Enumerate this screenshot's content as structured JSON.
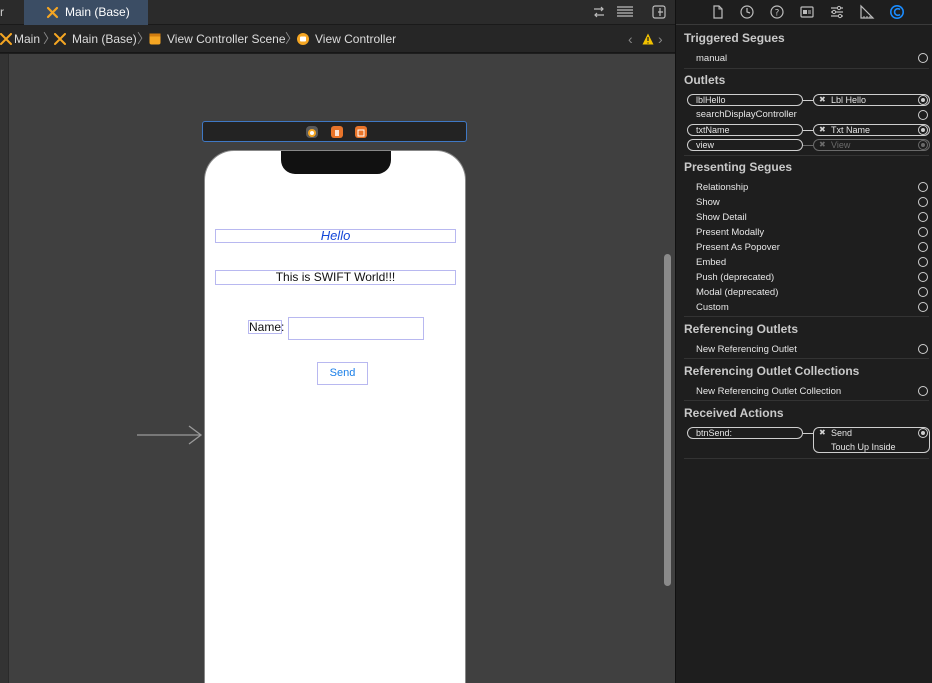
{
  "tabs": {
    "previous_fragment": "r",
    "active": "Main (Base)"
  },
  "breadcrumbs": [
    "Main",
    "Main (Base)",
    "View Controller Scene",
    "View Controller"
  ],
  "device": {
    "hello_label": "Hello",
    "world_label": "This is SWIFT World!!!",
    "name_label": "Name:",
    "name_field_value": "",
    "send_button": "Send"
  },
  "inspector": {
    "triggered_segues": {
      "title": "Triggered Segues",
      "items": [
        "manual"
      ]
    },
    "outlets": {
      "title": "Outlets",
      "items": [
        {
          "name": "lblHello",
          "target": "Lbl Hello",
          "connected": true
        },
        {
          "name": "searchDisplayController",
          "target": "",
          "connected": false
        },
        {
          "name": "txtName",
          "target": "Txt Name",
          "connected": true
        },
        {
          "name": "view",
          "target": "View",
          "connected": true,
          "dimmed": true
        }
      ]
    },
    "presenting_segues": {
      "title": "Presenting Segues",
      "items": [
        "Relationship",
        "Show",
        "Show Detail",
        "Present Modally",
        "Present As Popover",
        "Embed",
        "Push (deprecated)",
        "Modal (deprecated)",
        "Custom"
      ]
    },
    "referencing_outlets": {
      "title": "Referencing Outlets",
      "items": [
        "New Referencing Outlet"
      ]
    },
    "referencing_outlet_collections": {
      "title": "Referencing Outlet Collections",
      "items": [
        "New Referencing Outlet Collection"
      ]
    },
    "received_actions": {
      "title": "Received Actions",
      "action": "btnSend:",
      "target": "Send",
      "event": "Touch Up Inside"
    }
  },
  "colors": {
    "accent": "#1a8cff",
    "tab_active_bg": "#3b4d64",
    "canvas_bg": "#404040",
    "icon_orange": "#f5a623"
  }
}
